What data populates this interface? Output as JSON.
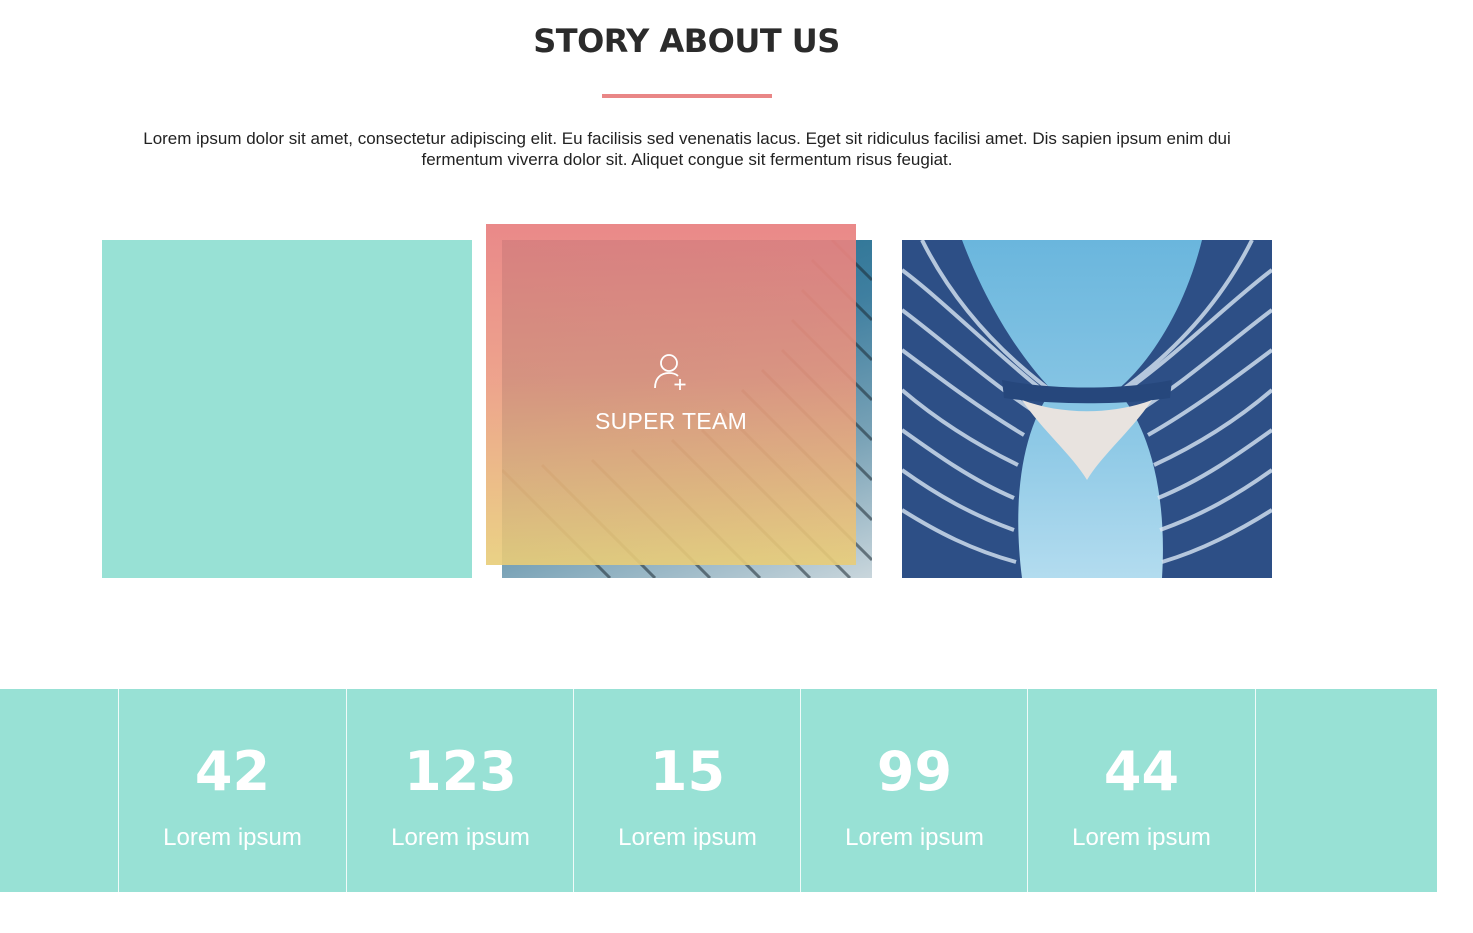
{
  "section": {
    "title": "STORY ABOUT US",
    "intro": "Lorem ipsum dolor sit amet, consectetur adipiscing elit. Eu facilisis sed venenatis lacus. Eget sit ridiculus facilisi amet. Dis sapien ipsum enim dui fermentum viverra dolor sit. Aliquet congue sit fermentum risus feugiat."
  },
  "cards": {
    "overlay": {
      "icon": "add-user-icon",
      "label": "SUPER TEAM"
    }
  },
  "stats": [
    {
      "value": "42",
      "label": "Lorem ipsum"
    },
    {
      "value": "123",
      "label": "Lorem ipsum"
    },
    {
      "value": "15",
      "label": "Lorem ipsum"
    },
    {
      "value": "99",
      "label": "Lorem ipsum"
    },
    {
      "value": "44",
      "label": "Lorem ipsum"
    }
  ],
  "colors": {
    "accent_mint": "#98e1d5",
    "accent_coral": "#e98686",
    "overlay_gradient_top": "#e88080",
    "overlay_gradient_bottom": "#e8cd78"
  }
}
